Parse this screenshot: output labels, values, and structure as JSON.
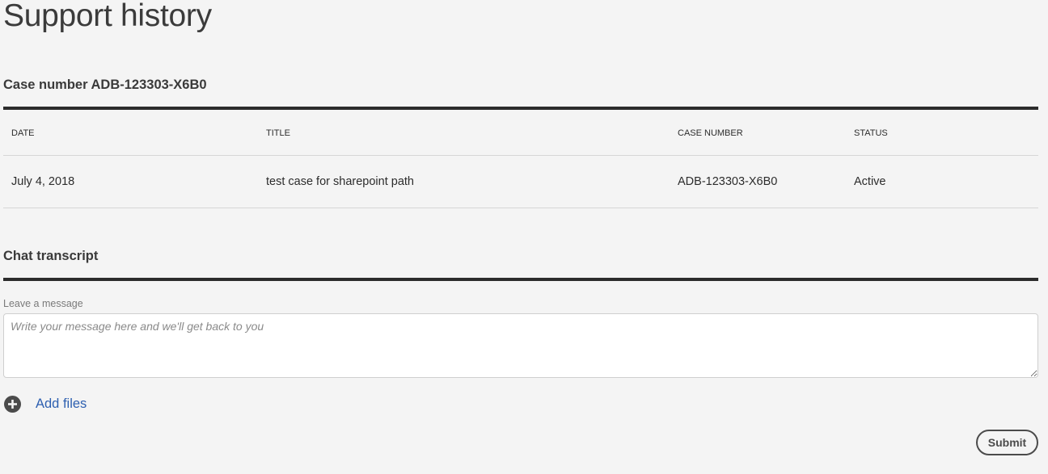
{
  "page": {
    "title": "Support history"
  },
  "case_section": {
    "heading": "Case number ADB-123303-X6B0",
    "table": {
      "headers": [
        "DATE",
        "TITLE",
        "CASE NUMBER",
        "STATUS"
      ],
      "rows": [
        [
          "July 4, 2018",
          "test case for sharepoint path",
          "ADB-123303-X6B0",
          "Active"
        ]
      ]
    }
  },
  "chat_section": {
    "heading": "Chat transcript",
    "message_label": "Leave a message",
    "message_placeholder": "Write your message here and we'll get back to you",
    "message_value": "",
    "add_files_icon": "plus-circle-icon",
    "add_files_label": "Add files",
    "submit_label": "Submit"
  },
  "colors": {
    "background": "#f4f4f4",
    "rule": "#2c2c2c",
    "link": "#2d5fb0",
    "icon": "#4b4b4b"
  }
}
